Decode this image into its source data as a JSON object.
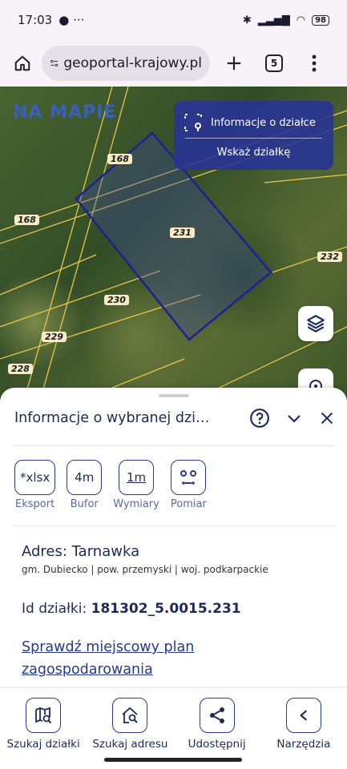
{
  "status": {
    "time": "17:03",
    "battery": "98"
  },
  "browser": {
    "url": "geoportal-krajowy.pl",
    "tabs": "5"
  },
  "map": {
    "logo": "NA MAPIE",
    "parcel_labels": [
      "168",
      "168",
      "231",
      "232",
      "230",
      "229",
      "228"
    ],
    "info_panel": {
      "title": "Informacje o działce",
      "action": "Wskaż działkę"
    }
  },
  "sheet": {
    "title": "Informacje o wybranej dzi…",
    "tools": [
      {
        "icon": "*xlsx",
        "label": "Eksport"
      },
      {
        "icon": "4m",
        "label": "Bufor"
      },
      {
        "icon": "1m",
        "label": "Wymiary"
      },
      {
        "icon": "measure-icon",
        "label": "Pomiar"
      }
    ],
    "address": "Adres: Tarnawka",
    "address_detail": "gm. Dubiecko | pow. przemyski | woj. podkarpackie",
    "id_label": "Id działki:",
    "id_value": "181302_5.0015.231",
    "plan_link": "Sprawdź miejscowy plan zagospodarowania"
  },
  "nav": [
    {
      "label": "Szukaj działki",
      "icon": "map-search-icon"
    },
    {
      "label": "Szukaj adresu",
      "icon": "home-search-icon"
    },
    {
      "label": "Udostępnij",
      "icon": "share-icon"
    },
    {
      "label": "Narzędzia",
      "icon": "tools-icon"
    }
  ]
}
